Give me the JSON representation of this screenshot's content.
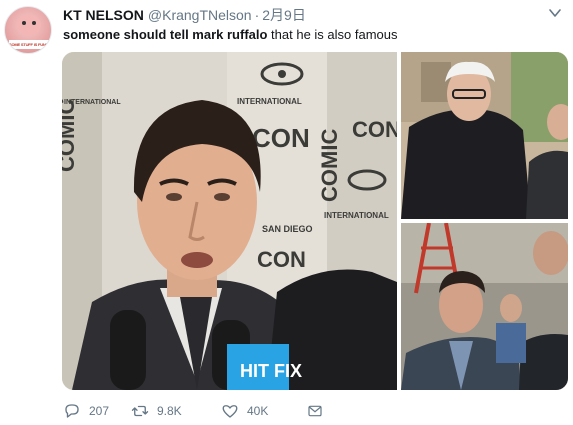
{
  "author": {
    "display_name": "KT NELSON",
    "handle": "@KrangTNelson",
    "timestamp": "2月9日",
    "avatar_caption": "SOME STUFF IS FUNNY BUT"
  },
  "tweet": {
    "bold_text": "someone should tell mark ruffalo",
    "text": " that he is also famous"
  },
  "media": {
    "main_sign_words": [
      "COMIC",
      "CON",
      "INTERNATIONAL",
      "SAN DIEGO"
    ],
    "mic_flag_text": "HIT FIX"
  },
  "actions": {
    "reply_count": "207",
    "retweet_count": "9.8K",
    "like_count": "40K"
  },
  "icons": {
    "reply": "reply-icon",
    "retweet": "retweet-icon",
    "like": "heart-icon",
    "dm": "envelope-icon",
    "caret": "chevron-down-icon"
  },
  "colors": {
    "text": "#14171a",
    "secondary": "#657786",
    "background": "#ffffff"
  }
}
